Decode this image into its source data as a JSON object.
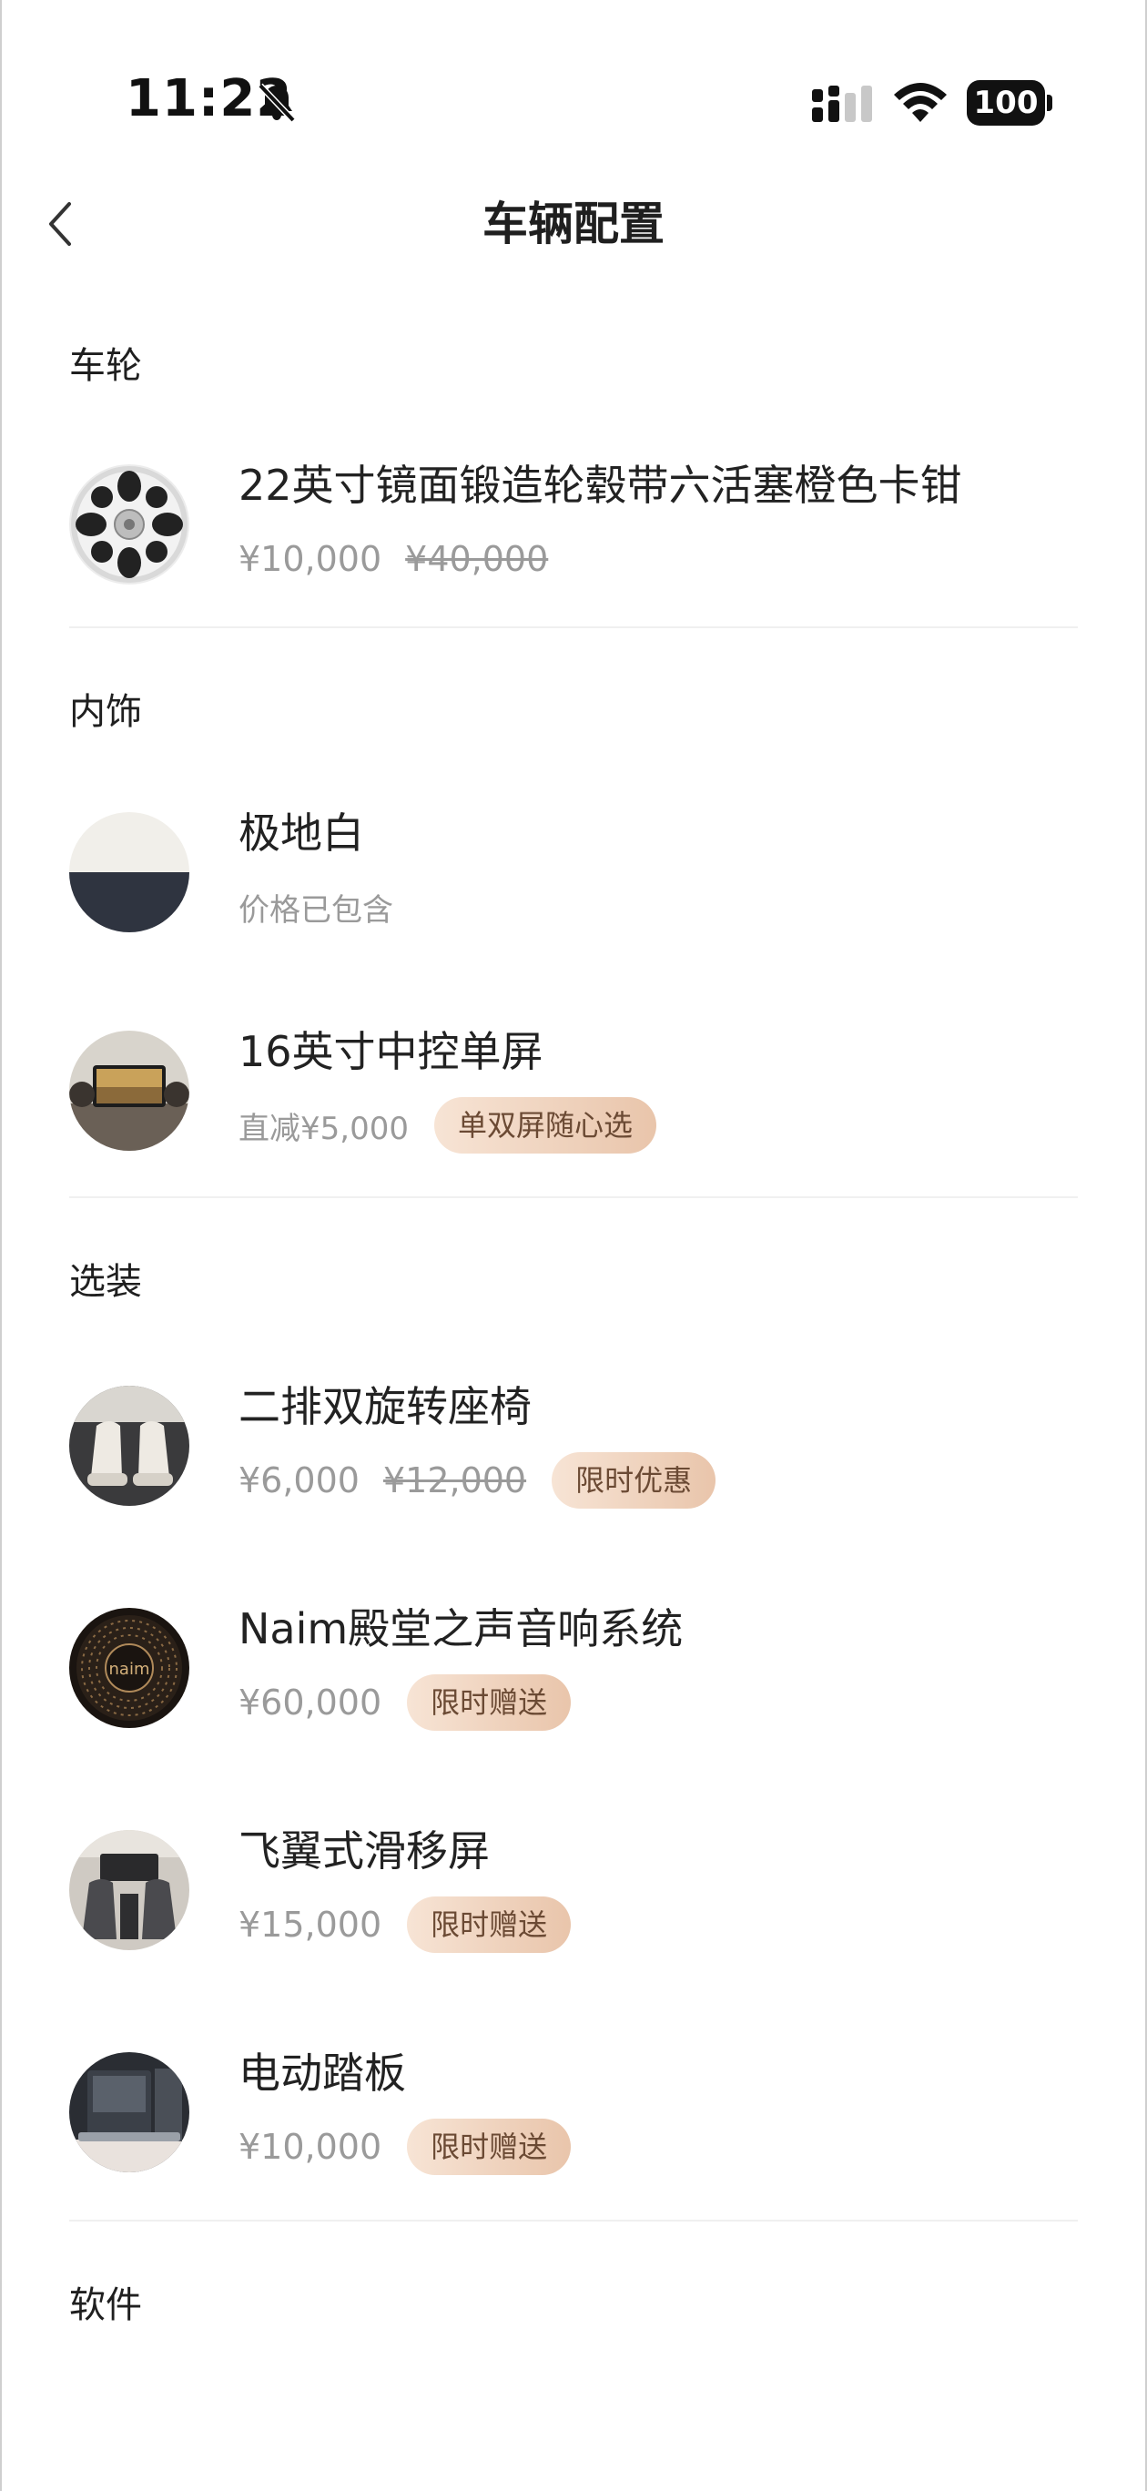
{
  "status_bar": {
    "time": "11:22",
    "battery": "100"
  },
  "header": {
    "title": "车辆配置"
  },
  "sections": [
    {
      "label": "车轮",
      "items": [
        {
          "name": "22英寸镜面锻造轮毂带六活塞橙色卡钳",
          "price": "¥10,000",
          "original_price": "¥40,000",
          "thumb": "wheel-icon"
        }
      ]
    },
    {
      "label": "内饰",
      "items": [
        {
          "name": "极地白",
          "price_note": "价格已包含",
          "thumb": "interior-color-swatch"
        },
        {
          "name": "16英寸中控单屏",
          "price_note": "直减¥5,000",
          "badge": "单双屏随心选",
          "thumb": "center-screen-thumbnail"
        }
      ]
    },
    {
      "label": "选装",
      "items": [
        {
          "name": "二排双旋转座椅",
          "price": "¥6,000",
          "original_price": "¥12,000",
          "badge": "限时优惠",
          "thumb": "seat-thumbnail"
        },
        {
          "name": "Naim殿堂之声音响系统",
          "price": "¥60,000",
          "badge": "限时赠送",
          "thumb": "speaker-thumbnail",
          "thumb_text": "naim"
        },
        {
          "name": "飞翼式滑移屏",
          "price": "¥15,000",
          "badge": "限时赠送",
          "thumb": "sliding-screen-thumbnail"
        },
        {
          "name": "电动踏板",
          "price": "¥10,000",
          "badge": "限时赠送",
          "thumb": "running-board-thumbnail"
        }
      ]
    },
    {
      "label": "软件",
      "items": []
    }
  ],
  "colors": {
    "badge_text": "#6b4a34",
    "badge_start": "#f7e4d5",
    "badge_end": "#e9c5ab",
    "muted_text": "#9a9a9a",
    "primary_text": "#1f1f1f"
  }
}
